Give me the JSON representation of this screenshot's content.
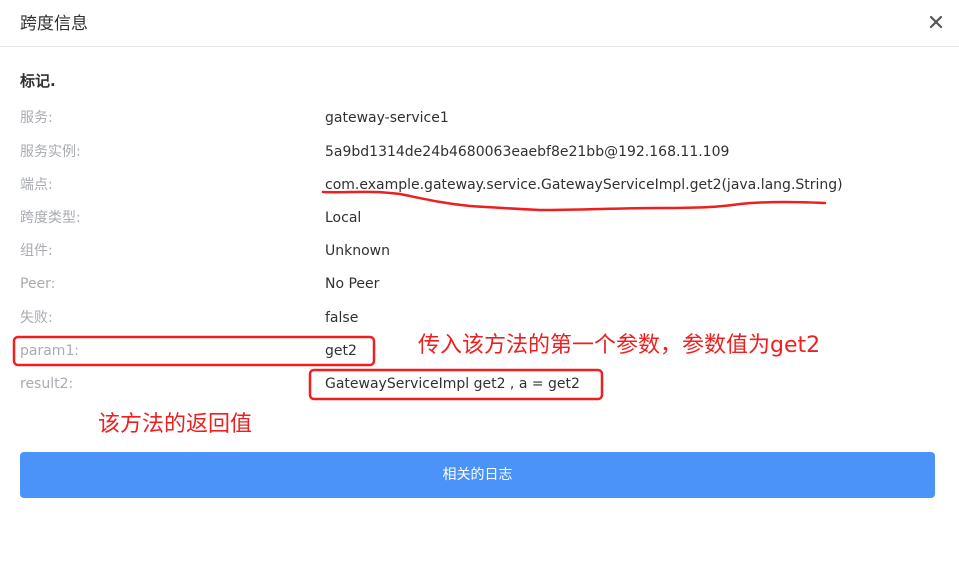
{
  "dialog": {
    "title": "跨度信息",
    "close_icon": "close-icon"
  },
  "section": {
    "title": "标记."
  },
  "rows": [
    {
      "label": "服务:",
      "value": "gateway-service1"
    },
    {
      "label": "服务实例:",
      "value": "5a9bd1314de24b4680063eaebf8e21bb@192.168.11.109"
    },
    {
      "label": "端点:",
      "value": "com.example.gateway.service.GatewayServiceImpl.get2(java.lang.String)"
    },
    {
      "label": "跨度类型:",
      "value": "Local"
    },
    {
      "label": "组件:",
      "value": "Unknown"
    },
    {
      "label": "Peer:",
      "value": "No Peer"
    },
    {
      "label": "失败:",
      "value": "false"
    },
    {
      "label": "param1:",
      "value": "get2"
    },
    {
      "label": "result2:",
      "value": "GatewayServiceImpl get2 , a = get2"
    }
  ],
  "annotations": {
    "param_note": "传入该方法的第一个参数，参数值为get2",
    "return_note": "该方法的返回值",
    "color": "#ee1f1f"
  },
  "footer": {
    "logs_button": "相关的日志",
    "button_color": "#4b93f8"
  }
}
